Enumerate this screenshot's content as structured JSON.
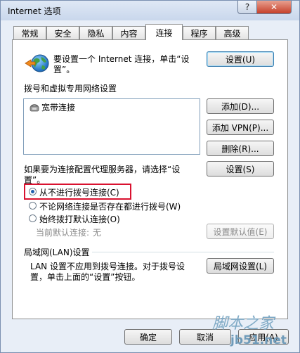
{
  "window": {
    "title": "Internet 选项",
    "help_label": "?",
    "close_label": "✕"
  },
  "tabs": [
    {
      "label": "常规",
      "active": false
    },
    {
      "label": "安全",
      "active": false
    },
    {
      "label": "隐私",
      "active": false
    },
    {
      "label": "内容",
      "active": false
    },
    {
      "label": "连接",
      "active": true
    },
    {
      "label": "程序",
      "active": false
    },
    {
      "label": "高级",
      "active": false
    }
  ],
  "setup": {
    "text_line1": "要设置一个 Internet 连接，单击“设",
    "text_line2": "置”。",
    "button": "设置(U)"
  },
  "dialup": {
    "heading": "拨号和虚拟专用网络设置",
    "list_items": [
      "宽带连接"
    ],
    "add_button": "添加(D)...",
    "add_vpn_button": "添加 VPN(P)...",
    "delete_button": "删除(R)...",
    "proxy_text_line1": "如果要为连接配置代理服务器，请选择“设",
    "proxy_text_line2": "置”。",
    "settings_button": "设置(S)"
  },
  "radios": [
    {
      "label": "从不进行拨号连接(C)",
      "checked": true
    },
    {
      "label": "不论网络连接是否存在都进行拨号(W)",
      "checked": false
    },
    {
      "label": "始终拨打默认连接(O)",
      "checked": false
    }
  ],
  "default": {
    "label": "当前默认连接:",
    "value": "无",
    "button": "设置默认值(E)"
  },
  "lan": {
    "heading": "局域网(LAN)设置",
    "text_line1": "LAN 设置不应用到拨号连接。对于拨号设",
    "text_line2": "置，单击上面的“设置”按钮。",
    "button": "局域网设置(L)"
  },
  "footer": {
    "ok": "确定",
    "cancel": "取消",
    "apply": "应用(A)"
  },
  "watermark": {
    "line1": "脚本之家",
    "line2": "jb51.net"
  }
}
